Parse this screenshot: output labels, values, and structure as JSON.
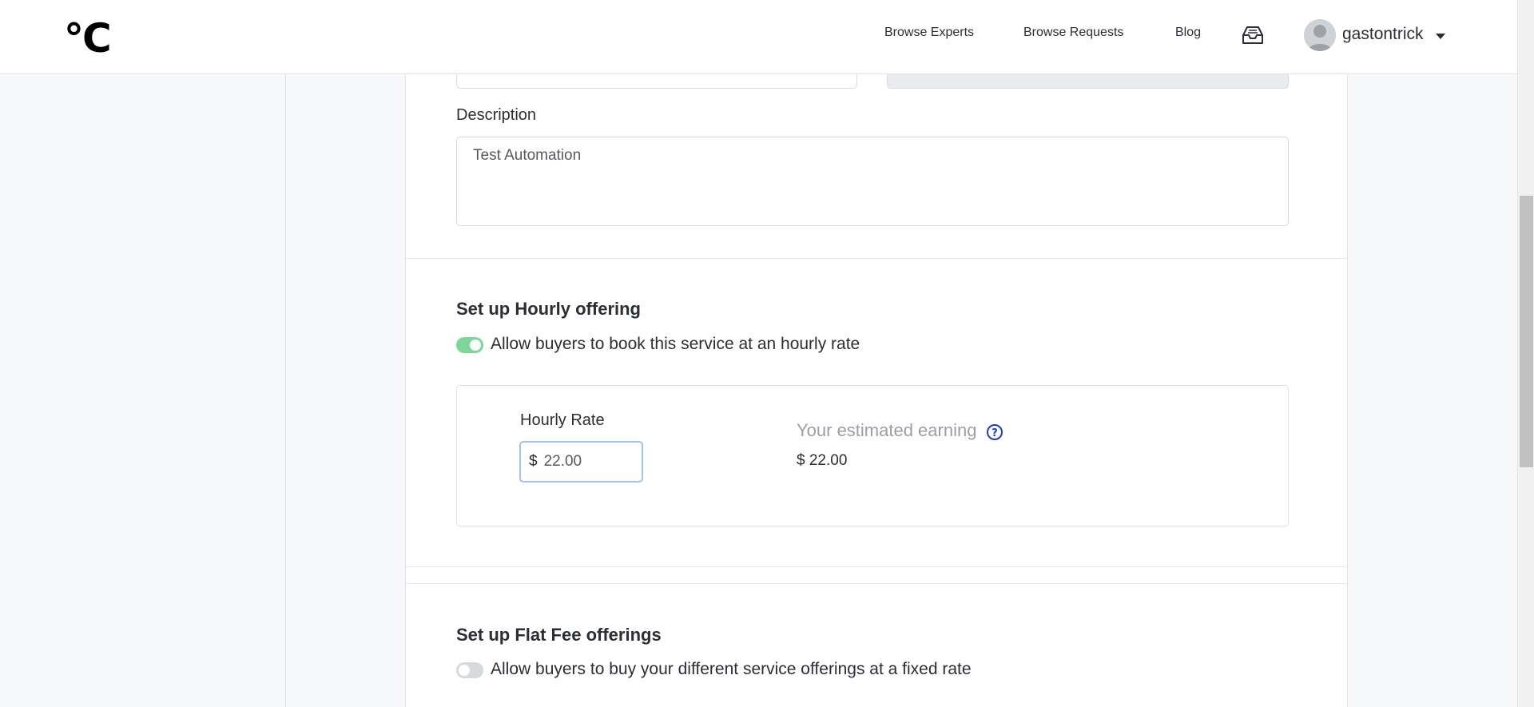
{
  "header": {
    "logo": "°C",
    "nav": {
      "browse_experts": "Browse Experts",
      "browse_requests": "Browse Requests",
      "blog": "Blog"
    },
    "user": {
      "username": "gastontrick"
    }
  },
  "form": {
    "description_label": "Description",
    "description_value": "Test Automation",
    "hourly": {
      "title": "Set up Hourly offering",
      "toggle_label": "Allow buyers to book this service at an hourly rate",
      "toggle_on": true,
      "rate_label": "Hourly Rate",
      "currency_symbol": "$",
      "rate_value": "22.00",
      "estimate_title": "Your estimated earning",
      "estimate_value": "$ 22.00"
    },
    "flat_fee": {
      "title": "Set up Flat Fee offerings",
      "toggle_label": "Allow buyers to buy your different service offerings at a fixed rate",
      "toggle_on": false
    }
  },
  "colors": {
    "toggle_on": "#7fd49b",
    "toggle_off": "#d7dadd",
    "help_icon": "#1a3fc4",
    "input_focus_border": "#9fc3ee"
  }
}
